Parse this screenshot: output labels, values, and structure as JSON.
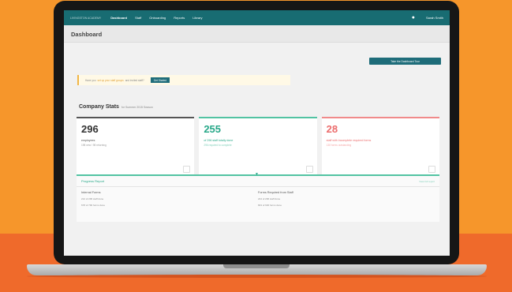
{
  "topbar": {
    "logo": "LIVINGSTON ACADEMY",
    "nav": [
      "Dashboard",
      "Staff",
      "Onboarding",
      "Reports",
      "Library"
    ],
    "user": "Sarah Smith"
  },
  "page_title": "Dashboard",
  "tour_button": "Take the Dashboard Tour",
  "notice": {
    "text_before": "Have you",
    "link": "set up your staff groups",
    "text_after": "and invited staff?",
    "button": "Get Started"
  },
  "stats": {
    "title": "Company Stats",
    "subtitle": "for Summer 2015 Season",
    "cards": [
      {
        "number": "296",
        "label": "employees",
        "sub": "198 new / 98 returning"
      },
      {
        "number": "255",
        "label": "of 296 staff totally done",
        "sub": "296 required to complete"
      },
      {
        "number": "28",
        "label": "staff with incomplete required forms",
        "sub": "138 forms outstanding"
      }
    ]
  },
  "progress": {
    "title": "Progress Report",
    "right": "View full report",
    "columns": [
      {
        "heading": "Internal Forms",
        "lines": [
          "212 of 296 staff done",
          "678 of 790 forms done"
        ]
      },
      {
        "heading": "Forms Required from Staff",
        "lines": [
          "244 of 296 staff done",
          "843 of 930 forms done"
        ]
      }
    ]
  }
}
